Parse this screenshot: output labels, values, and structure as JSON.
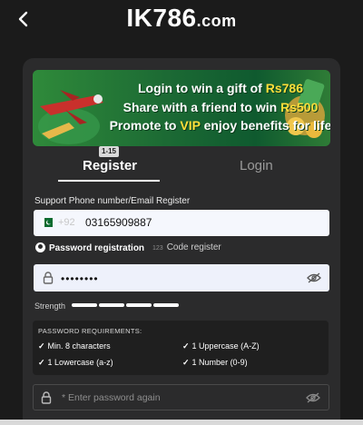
{
  "header": {
    "brand_main": "IK786",
    "brand_tld": ".com",
    "back_icon": "chevron-left-icon"
  },
  "banner": {
    "line1_prefix": "Login to win a gift of ",
    "line1_highlight": "Rs786",
    "line2_prefix": "Share with a friend to win ",
    "line2_highlight": "Rs500",
    "line3_prefix": "Promote to ",
    "line3_highlight": "VIP",
    "line3_suffix": " enjoy benefits for life",
    "highlight_color": "#ffdf3a"
  },
  "tabs": {
    "badge": "1-15",
    "register": "Register",
    "login": "Login"
  },
  "form": {
    "support_label": "Support Phone number/Email Register",
    "country_code": "+92",
    "phone_value": "03165909887",
    "mode_password": "Password registration",
    "mode_code_num": "123",
    "mode_code": "Code register",
    "password_value": "••••••••",
    "strength_label": "Strength",
    "strength_level": 4,
    "confirm_placeholder": "* Enter password again"
  },
  "requirements": {
    "title": "PASSWORD REQUIREMENTS:",
    "check": "✓",
    "items": [
      "Min. 8 characters",
      "1 Uppercase (A-Z)",
      "1 Lowercase (a-z)",
      "1 Number (0-9)"
    ]
  }
}
